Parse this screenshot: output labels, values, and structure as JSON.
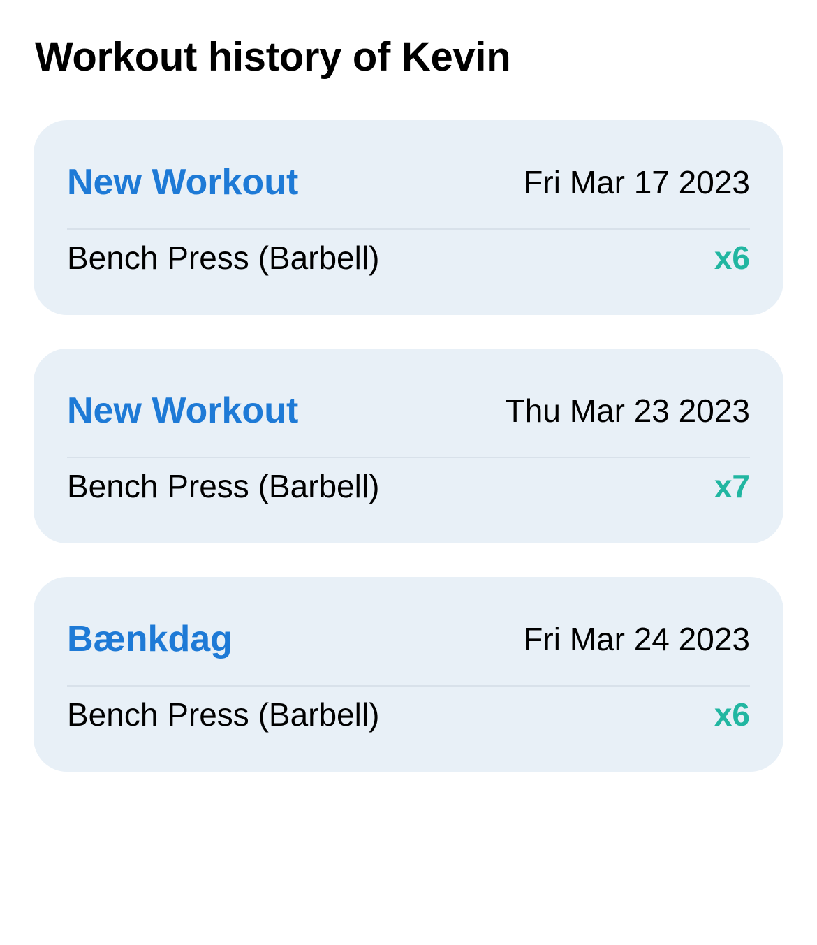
{
  "page": {
    "title": "Workout history of Kevin"
  },
  "colors": {
    "workout_name": "#1e7ad6",
    "set_count": "#21b6a1",
    "card_background": "#e8f0f7"
  },
  "workouts": [
    {
      "name": "New Workout",
      "date": "Fri Mar 17 2023",
      "exercises": [
        {
          "name": "Bench Press (Barbell)",
          "sets": "x6"
        }
      ]
    },
    {
      "name": "New Workout",
      "date": "Thu Mar 23 2023",
      "exercises": [
        {
          "name": "Bench Press (Barbell)",
          "sets": "x7"
        }
      ]
    },
    {
      "name": "Bænkdag",
      "date": "Fri Mar 24 2023",
      "exercises": [
        {
          "name": "Bench Press (Barbell)",
          "sets": "x6"
        }
      ]
    }
  ]
}
